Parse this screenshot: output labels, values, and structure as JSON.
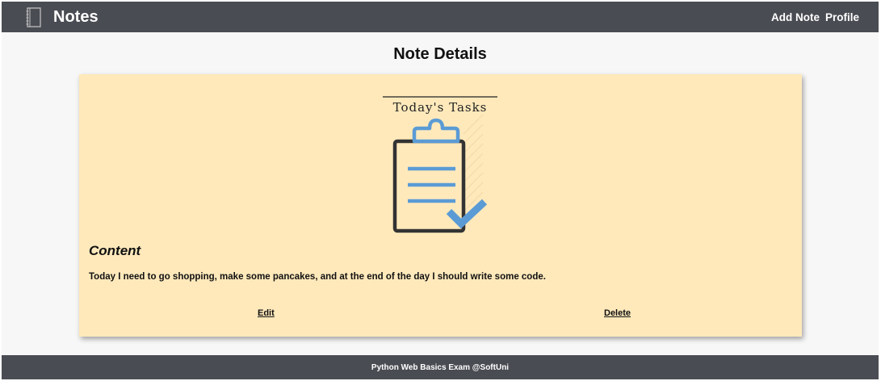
{
  "header": {
    "brand_icon": "notebook-icon",
    "title": "Notes",
    "nav": [
      {
        "label": "Add Note"
      },
      {
        "label": "Profile"
      }
    ]
  },
  "page": {
    "title": "Note Details"
  },
  "note": {
    "image_caption": "Today's Tasks",
    "image_icon": "clipboard-check-icon",
    "content_heading": "Content",
    "content_text": "Today I need to go shopping, make some pancakes, and at the end of the day I should write some code.",
    "edit_label": "Edit",
    "delete_label": "Delete"
  },
  "footer": {
    "text": "Python Web Basics Exam @SoftUni"
  },
  "colors": {
    "bar": "#4a4c53",
    "page_bg": "#f7f7f7",
    "card_bg": "#ffe9bb",
    "accent_blue": "#5b9bd5",
    "ink": "#333333"
  }
}
